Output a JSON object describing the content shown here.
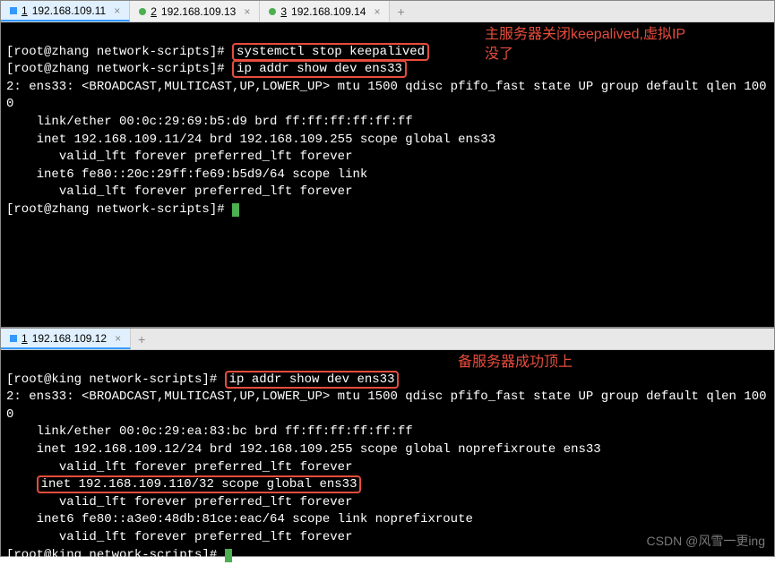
{
  "top": {
    "tabs": [
      {
        "num": "1",
        "label": "192.168.109.11",
        "active": true,
        "dot": "blue"
      },
      {
        "num": "2",
        "label": "192.168.109.13",
        "active": false,
        "dot": "green"
      },
      {
        "num": "3",
        "label": "192.168.109.14",
        "active": false,
        "dot": "green"
      }
    ],
    "prompt1": "[root@zhang network-scripts]# ",
    "cmd1": "systemctl stop keepalived",
    "prompt2": "[root@zhang network-scripts]# ",
    "cmd2": "ip addr show dev ens33",
    "annotation1": "主服务器关闭keepalived,虚拟IP",
    "annotation2": "没了",
    "out_line1": "2: ens33: <BROADCAST,MULTICAST,UP,LOWER_UP> mtu 1500 qdisc pfifo_fast state UP group default qlen 1000",
    "out_line2": "    link/ether 00:0c:29:69:b5:d9 brd ff:ff:ff:ff:ff:ff",
    "out_line3": "    inet 192.168.109.11/24 brd 192.168.109.255 scope global ens33",
    "out_line4": "       valid_lft forever preferred_lft forever",
    "out_line5": "    inet6 fe80::20c:29ff:fe69:b5d9/64 scope link",
    "out_line6": "       valid_lft forever preferred_lft forever",
    "prompt3": "[root@zhang network-scripts]# "
  },
  "bottom": {
    "tabs": [
      {
        "num": "1",
        "label": "192.168.109.12",
        "active": true,
        "dot": "blue"
      }
    ],
    "prompt1": "[root@king network-scripts]# ",
    "cmd1": "ip addr show dev ens33",
    "annotation": "备服务器成功顶上",
    "out_line1": "2: ens33: <BROADCAST,MULTICAST,UP,LOWER_UP> mtu 1500 qdisc pfifo_fast state UP group default qlen 1000",
    "out_line2": "    link/ether 00:0c:29:ea:83:bc brd ff:ff:ff:ff:ff:ff",
    "out_line3": "    inet 192.168.109.12/24 brd 192.168.109.255 scope global noprefixroute ens33",
    "out_line4": "       valid_lft forever preferred_lft forever",
    "out_line5_pre": "    ",
    "out_line5_box": "inet 192.168.109.110/32 scope global ens33",
    "out_line6": "       valid_lft forever preferred_lft forever",
    "out_line7": "    inet6 fe80::a3e0:48db:81ce:eac/64 scope link noprefixroute",
    "out_line8": "       valid_lft forever preferred_lft forever",
    "prompt2": "[root@king network-scripts]# "
  },
  "watermark": "CSDN @风雪一更ing"
}
